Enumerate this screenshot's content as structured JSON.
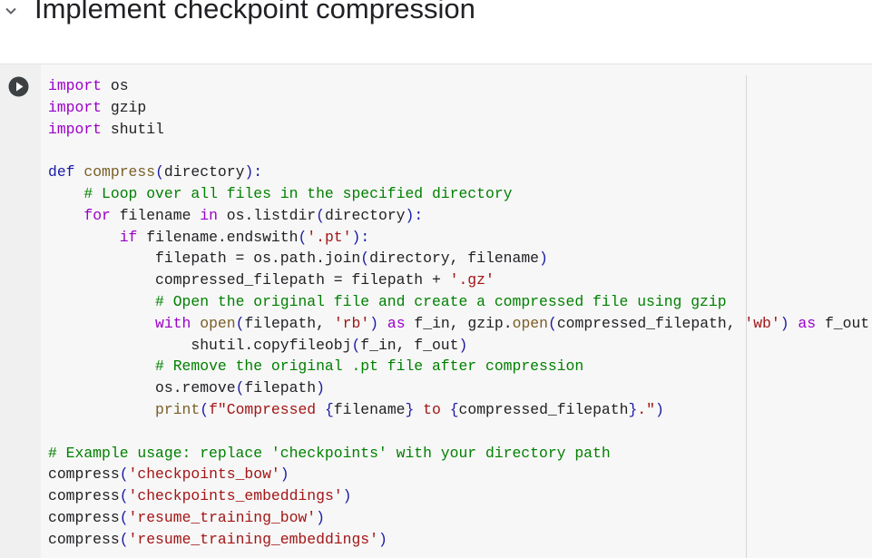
{
  "section": {
    "title": "Implement checkpoint compression"
  },
  "code": {
    "lines": [
      [
        {
          "t": "import",
          "c": "kw"
        },
        {
          "t": " os"
        }
      ],
      [
        {
          "t": "import",
          "c": "kw"
        },
        {
          "t": " gzip"
        }
      ],
      [
        {
          "t": "import",
          "c": "kw"
        },
        {
          "t": " shutil"
        }
      ],
      [],
      [
        {
          "t": "def",
          "c": "bk"
        },
        {
          "t": " "
        },
        {
          "t": "compress",
          "c": "fn"
        },
        {
          "t": "(",
          "c": "bk"
        },
        {
          "t": "directory"
        },
        {
          "t": "):",
          "c": "bk"
        }
      ],
      [
        {
          "t": "    "
        },
        {
          "t": "# Loop over all files in the specified directory",
          "c": "cm"
        }
      ],
      [
        {
          "t": "    "
        },
        {
          "t": "for",
          "c": "kw"
        },
        {
          "t": " filename "
        },
        {
          "t": "in",
          "c": "kw"
        },
        {
          "t": " os.listdir"
        },
        {
          "t": "(",
          "c": "bk"
        },
        {
          "t": "directory"
        },
        {
          "t": "):",
          "c": "bk"
        }
      ],
      [
        {
          "t": "        "
        },
        {
          "t": "if",
          "c": "kw"
        },
        {
          "t": " filename.endswith"
        },
        {
          "t": "(",
          "c": "bk"
        },
        {
          "t": "'.pt'",
          "c": "str"
        },
        {
          "t": "):",
          "c": "bk"
        }
      ],
      [
        {
          "t": "            filepath = os.path.join"
        },
        {
          "t": "(",
          "c": "bk"
        },
        {
          "t": "directory, filename"
        },
        {
          "t": ")",
          "c": "bk"
        }
      ],
      [
        {
          "t": "            compressed_filepath = filepath + "
        },
        {
          "t": "'.gz'",
          "c": "str"
        }
      ],
      [
        {
          "t": "            "
        },
        {
          "t": "# Open the original file and create a compressed file using gzip",
          "c": "cm"
        }
      ],
      [
        {
          "t": "            "
        },
        {
          "t": "with",
          "c": "kw"
        },
        {
          "t": " "
        },
        {
          "t": "open",
          "c": "fn"
        },
        {
          "t": "(",
          "c": "bk"
        },
        {
          "t": "filepath, "
        },
        {
          "t": "'rb'",
          "c": "str"
        },
        {
          "t": ")",
          "c": "bk"
        },
        {
          "t": " "
        },
        {
          "t": "as",
          "c": "kw"
        },
        {
          "t": " f_in, gzip."
        },
        {
          "t": "open",
          "c": "fn"
        },
        {
          "t": "(",
          "c": "bk"
        },
        {
          "t": "compressed_filepath, "
        },
        {
          "t": "'wb'",
          "c": "str"
        },
        {
          "t": ")",
          "c": "bk"
        },
        {
          "t": " "
        },
        {
          "t": "as",
          "c": "kw"
        },
        {
          "t": " f_out:"
        }
      ],
      [
        {
          "t": "                shutil.copyfileobj"
        },
        {
          "t": "(",
          "c": "bk"
        },
        {
          "t": "f_in, f_out"
        },
        {
          "t": ")",
          "c": "bk"
        }
      ],
      [
        {
          "t": "            "
        },
        {
          "t": "# Remove the original .pt file after compression",
          "c": "cm"
        }
      ],
      [
        {
          "t": "            os.remove"
        },
        {
          "t": "(",
          "c": "bk"
        },
        {
          "t": "filepath"
        },
        {
          "t": ")",
          "c": "bk"
        }
      ],
      [
        {
          "t": "            "
        },
        {
          "t": "print",
          "c": "fn"
        },
        {
          "t": "(",
          "c": "bk"
        },
        {
          "t": "f\"Compressed ",
          "c": "str"
        },
        {
          "t": "{",
          "c": "bk"
        },
        {
          "t": "filename"
        },
        {
          "t": "}",
          "c": "bk"
        },
        {
          "t": " to ",
          "c": "str"
        },
        {
          "t": "{",
          "c": "bk"
        },
        {
          "t": "compressed_filepath"
        },
        {
          "t": "}",
          "c": "bk"
        },
        {
          "t": ".\"",
          "c": "str"
        },
        {
          "t": ")",
          "c": "bk"
        }
      ],
      [],
      [
        {
          "t": "# Example usage: replace 'checkpoints' with your directory path",
          "c": "cm"
        }
      ],
      [
        {
          "t": "compress"
        },
        {
          "t": "(",
          "c": "bk"
        },
        {
          "t": "'checkpoints_bow'",
          "c": "str"
        },
        {
          "t": ")",
          "c": "bk"
        }
      ],
      [
        {
          "t": "compress"
        },
        {
          "t": "(",
          "c": "bk"
        },
        {
          "t": "'checkpoints_embeddings'",
          "c": "str"
        },
        {
          "t": ")",
          "c": "bk"
        }
      ],
      [
        {
          "t": "compress"
        },
        {
          "t": "(",
          "c": "bk"
        },
        {
          "t": "'resume_training_bow'",
          "c": "str"
        },
        {
          "t": ")",
          "c": "bk"
        }
      ],
      [
        {
          "t": "compress"
        },
        {
          "t": "(",
          "c": "bk"
        },
        {
          "t": "'resume_training_embeddings'",
          "c": "str"
        },
        {
          "t": ")",
          "c": "bk"
        }
      ]
    ]
  },
  "icons": {
    "collapse": "chevron-down-icon",
    "run": "play-icon"
  },
  "colors": {
    "keyword": "#9a00c9",
    "bracket": "#1a1aa6",
    "function": "#795e26",
    "string": "#a31515",
    "comment": "#008000"
  }
}
